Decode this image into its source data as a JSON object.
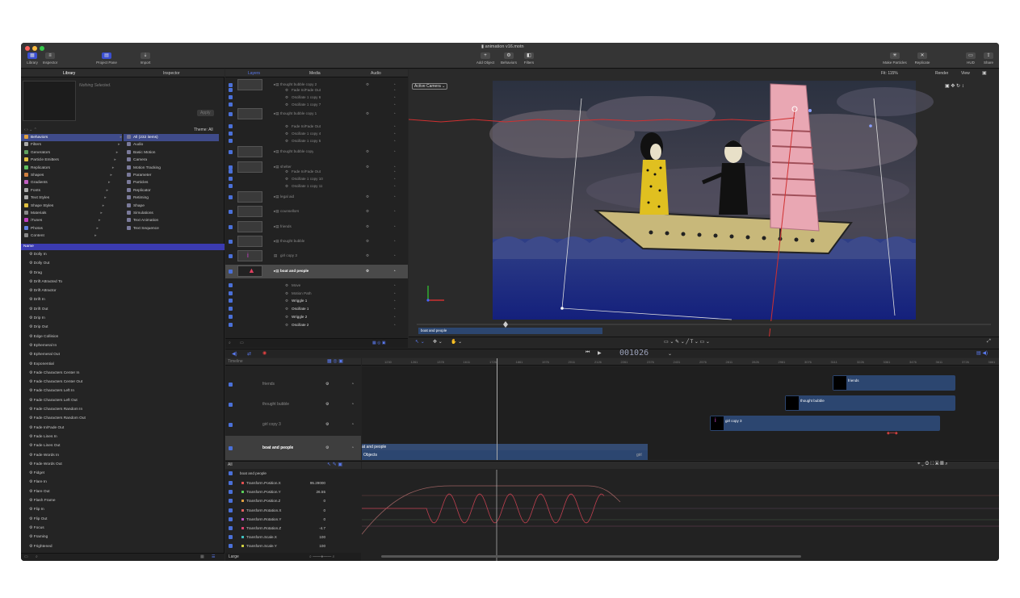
{
  "window": {
    "title": "animation v16.motn"
  },
  "toolbar": {
    "library": "Library",
    "inspector": "Inspector",
    "project_pane": "Project Pane",
    "import": "Import",
    "add_object": "Add Object",
    "behaviors": "Behaviors",
    "filters": "Filters",
    "make_particles": "Make Particles",
    "replicate": "Replicate",
    "hud": "HUD",
    "share": "Share"
  },
  "left_panel": {
    "tab_library": "Library",
    "tab_inspector": "Inspector",
    "nothing_selected": "Nothing Selected.",
    "apply": "Apply",
    "theme": "Theme: All",
    "categories": [
      "Behaviors",
      "Filters",
      "Generators",
      "Particle Emitters",
      "Replicators",
      "Shapes",
      "Gradients",
      "Fonts",
      "Text Styles",
      "Shape Styles",
      "Materials",
      "iTunes",
      "Photos",
      "Content"
    ],
    "subcategories": [
      "All (232 items)",
      "Audio",
      "Basic Motion",
      "Camera",
      "Motion Tracking",
      "Parameter",
      "Particles",
      "Replicator",
      "Retiming",
      "Shape",
      "Simulations",
      "Text Animation",
      "Text Sequence"
    ],
    "name_header": "Name",
    "items": [
      "Dolly In",
      "Dolly Out",
      "Drag",
      "Drift Attracted To",
      "Drift Attractor",
      "Drift In",
      "Drift Out",
      "Drip In",
      "Drip Out",
      "Edge Collision",
      "Ephemeral In",
      "Ephemeral Out",
      "Exponential",
      "Fade Characters Center In",
      "Fade Characters Center Out",
      "Fade Characters Left In",
      "Fade Characters Left Out",
      "Fade Characters Random In",
      "Fade Characters Random Out",
      "Fade In/Fade Out",
      "Fade Lines In",
      "Fade Lines Out",
      "Fade Words In",
      "Fade Words Out",
      "Fidget",
      "Flare In",
      "Flare Out",
      "Flash Frame",
      "Flip In",
      "Flip Out",
      "Focus",
      "Framing",
      "Frightened"
    ]
  },
  "layers_panel": {
    "tab_layers": "Layers",
    "tab_media": "Media",
    "tab_audio": "Audio",
    "rows": [
      {
        "name": "thought bubble copy 2",
        "kind": "group"
      },
      {
        "name": "Fade In/Fade Out",
        "kind": "behavior"
      },
      {
        "name": "Oscillate 1 copy 6",
        "kind": "behavior"
      },
      {
        "name": "Oscillate 1 copy 7",
        "kind": "behavior"
      },
      {
        "name": "thought bubble copy 1",
        "kind": "group"
      },
      {
        "name": "Fade In/Fade Out",
        "kind": "behavior"
      },
      {
        "name": "Oscillate 1 copy 4",
        "kind": "behavior"
      },
      {
        "name": "Oscillate 1 copy 5",
        "kind": "behavior"
      },
      {
        "name": "thought bubble copy",
        "kind": "group"
      },
      {
        "name": "shelter",
        "kind": "group"
      },
      {
        "name": "Fade In/Fade Out",
        "kind": "behavior"
      },
      {
        "name": "Oscillate 1 copy 10",
        "kind": "behavior"
      },
      {
        "name": "Oscillate 1 copy 11",
        "kind": "behavior"
      },
      {
        "name": "legal aid",
        "kind": "group"
      },
      {
        "name": "counsellors",
        "kind": "group"
      },
      {
        "name": "friends",
        "kind": "group"
      },
      {
        "name": "thought bubble",
        "kind": "group"
      },
      {
        "name": "girl copy 3",
        "kind": "layer"
      },
      {
        "name": "boat and people",
        "kind": "group"
      },
      {
        "name": "Move",
        "kind": "behavior"
      },
      {
        "name": "Motion Path",
        "kind": "behavior"
      },
      {
        "name": "Wriggle 1",
        "kind": "behavior"
      },
      {
        "name": "Oscillate 1",
        "kind": "behavior"
      },
      {
        "name": "Wriggle 2",
        "kind": "behavior"
      },
      {
        "name": "Oscillate 2",
        "kind": "behavior"
      }
    ]
  },
  "canvas": {
    "camera": "Active Camera",
    "fit": "Fit: 115%",
    "render": "Render",
    "view": "View",
    "mini_timeline_label": "boat and people"
  },
  "transport": {
    "timecode": "001026"
  },
  "timeline": {
    "header": "Timeline",
    "ruler": [
      "1230",
      "1261",
      "1378",
      "1611",
      "1726",
      "1861",
      "1976",
      "2011",
      "2126",
      "2261",
      "2376",
      "2431",
      "2576",
      "2811",
      "2826",
      "2961",
      "3076",
      "3111",
      "3226",
      "3361",
      "3476",
      "3611",
      "3726",
      "3861"
    ],
    "tracks": [
      {
        "name": "friends"
      },
      {
        "name": "thought bubble"
      },
      {
        "name": "girl copy 3"
      },
      {
        "name": "boat and people"
      }
    ],
    "bars": {
      "friends": "friends",
      "thought_bubble": "thought bubble",
      "girl_copy_3": "girl copy 3",
      "boat_top": "at and people",
      "boat_objects": "Objects",
      "boat_girl": "girl"
    }
  },
  "keyframes": {
    "filter": "All",
    "group": "boat and people",
    "params": [
      {
        "name": "Transform.Position.X",
        "value": "95.29000",
        "color": "#e05050"
      },
      {
        "name": "Transform.Position.Y",
        "value": "26.55",
        "color": "#5ad05a"
      },
      {
        "name": "Transform.Position.Z",
        "value": "0",
        "color": "#e0a040"
      },
      {
        "name": "Transform.Rotation.X",
        "value": "0",
        "color": "#e06060"
      },
      {
        "name": "Transform.Rotation.Y",
        "value": "0",
        "color": "#c050c0"
      },
      {
        "name": "Transform.Rotation.Z",
        "value": "-4.7",
        "color": "#e04070"
      },
      {
        "name": "Transform.Scale.X",
        "value": "100",
        "color": "#40c0c0"
      },
      {
        "name": "Transform.Scale.Y",
        "value": "100",
        "color": "#d0d040"
      }
    ],
    "size": "Large"
  }
}
